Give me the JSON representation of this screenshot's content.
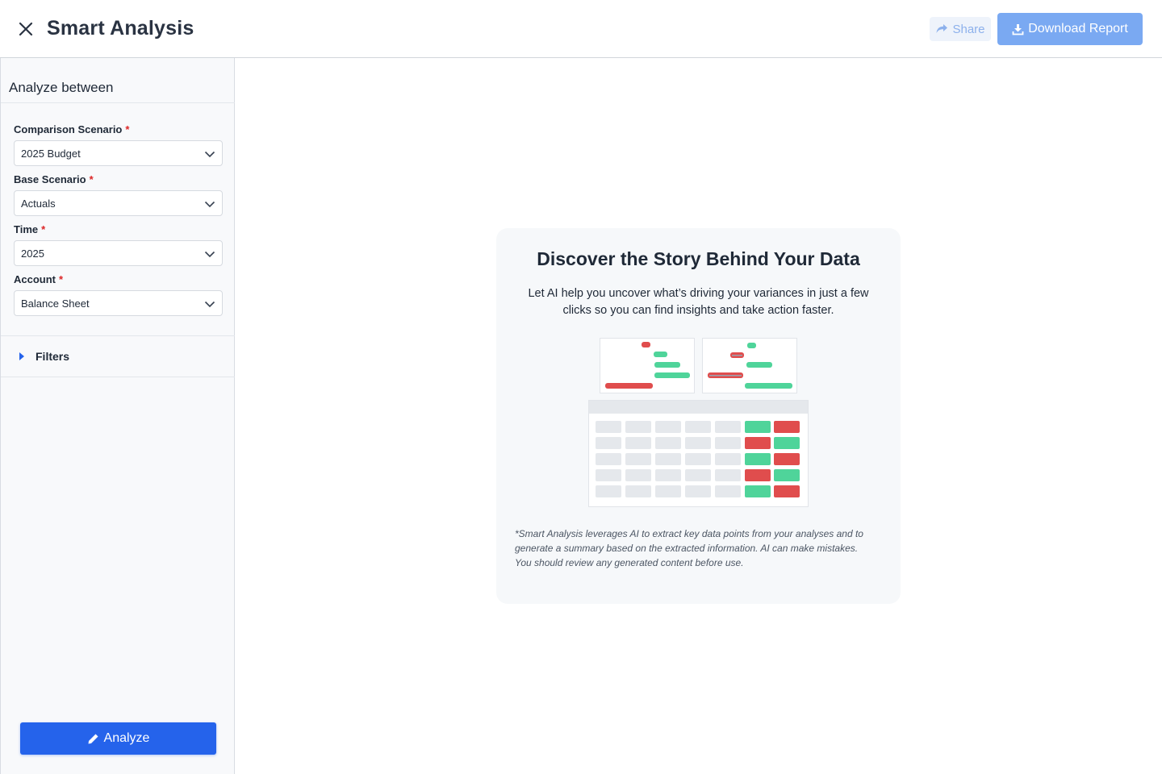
{
  "header": {
    "title": "Smart Analysis",
    "share_label": "Share",
    "download_label": "Download Report"
  },
  "sidebar": {
    "title": "Analyze between",
    "fields": [
      {
        "label": "Comparison Scenario",
        "required_mark": "*",
        "value": "2025 Budget"
      },
      {
        "label": "Base Scenario",
        "required_mark": "*",
        "value": "Actuals"
      },
      {
        "label": "Time",
        "required_mark": "*",
        "value": "2025"
      },
      {
        "label": "Account",
        "required_mark": "*",
        "value": "Balance Sheet"
      }
    ],
    "filters_label": "Filters",
    "analyze_label": "Analyze"
  },
  "card": {
    "title": "Discover the Story Behind Your Data",
    "description": "Let AI help you uncover what’s driving your variances in just a few clicks so you can find insights and take action faster.",
    "disclaimer": "*Smart Analysis leverages AI to extract key data points from your analyses and to generate a summary based on the extracted information. AI can make mistakes. You should review any generated content before use."
  },
  "colors": {
    "accent": "#2563eb",
    "positive": "#4fd49a",
    "negative": "#e04d4d",
    "placeholder_cell": "#e5e8ec"
  }
}
